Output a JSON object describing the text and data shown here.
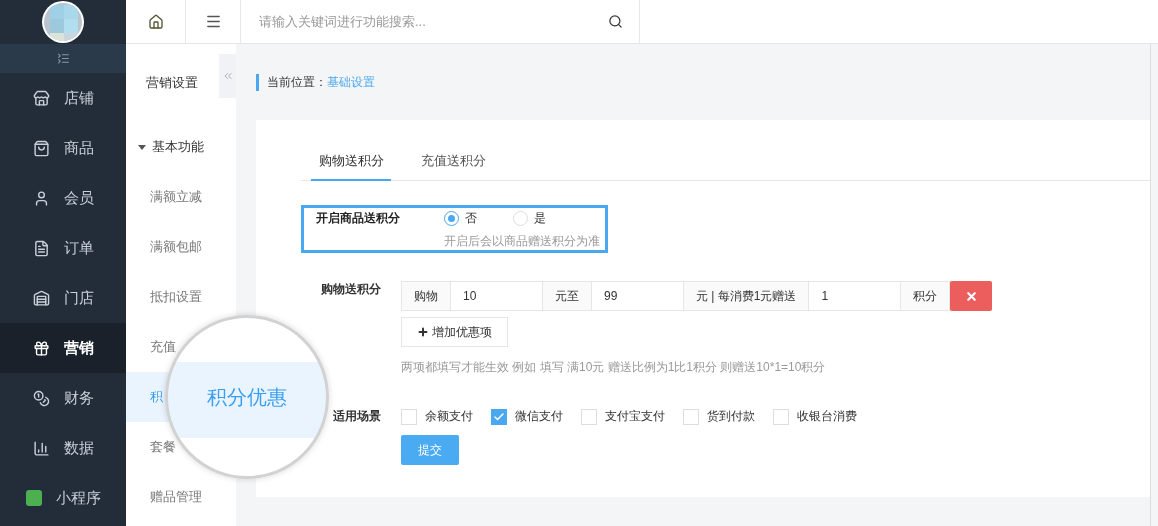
{
  "sidebar": {
    "items": [
      {
        "label": "店铺",
        "selected": false
      },
      {
        "label": "商品",
        "selected": false
      },
      {
        "label": "会员",
        "selected": false
      },
      {
        "label": "订单",
        "selected": false
      },
      {
        "label": "门店",
        "selected": false
      },
      {
        "label": "营销",
        "selected": true
      },
      {
        "label": "财务",
        "selected": false
      },
      {
        "label": "数据",
        "selected": false
      },
      {
        "label": "小程序",
        "selected": false
      }
    ]
  },
  "header": {
    "search": {
      "placeholder": "请输入关键词进行功能搜索..."
    }
  },
  "subnav": {
    "title": "营销设置",
    "groups": [
      {
        "label": "基本功能",
        "expanded": true,
        "children": [
          {
            "label": "满额立减",
            "selected": false
          },
          {
            "label": "满额包邮",
            "selected": false
          },
          {
            "label": "抵扣设置",
            "selected": false
          },
          {
            "label": "充值",
            "selected": false
          },
          {
            "label": "积",
            "selected": true
          },
          {
            "label": "套餐",
            "selected": false
          },
          {
            "label": "赠品管理",
            "selected": false
          }
        ]
      }
    ]
  },
  "magnifier": {
    "label": "积分优惠"
  },
  "breadcrumb": {
    "label": "当前位置：",
    "current": "基础设置"
  },
  "tabs": [
    {
      "label": "购物送积分",
      "selected": true
    },
    {
      "label": "充值送积分",
      "selected": false
    }
  ],
  "form": {
    "toggle": {
      "label": "开启商品送积分",
      "options": [
        {
          "label": "否",
          "selected": true
        },
        {
          "label": "是",
          "selected": false
        }
      ],
      "hint": "开启后会以商品赠送积分为准"
    },
    "rule": {
      "label": "购物送积分",
      "parts": [
        {
          "kind": "addon",
          "text": "购物"
        },
        {
          "kind": "input",
          "value": "10"
        },
        {
          "kind": "addon",
          "text": "元至"
        },
        {
          "kind": "input",
          "value": "99"
        },
        {
          "kind": "addon",
          "text": "元 | 每消费1元赠送"
        },
        {
          "kind": "input",
          "value": "1"
        },
        {
          "kind": "addon",
          "text": "积分"
        }
      ],
      "add_button": "增加优惠项",
      "hint": "两项都填写才能生效 例如 填写 满10元 赠送比例为1比1积分 则赠送10*1=10积分"
    },
    "scenes": {
      "label": "适用场景",
      "options": [
        {
          "label": "余额支付",
          "checked": false
        },
        {
          "label": "微信支付",
          "checked": true
        },
        {
          "label": "支付宝支付",
          "checked": false
        },
        {
          "label": "货到付款",
          "checked": false
        },
        {
          "label": "收银台消费",
          "checked": false
        }
      ]
    },
    "submit": "提交"
  }
}
